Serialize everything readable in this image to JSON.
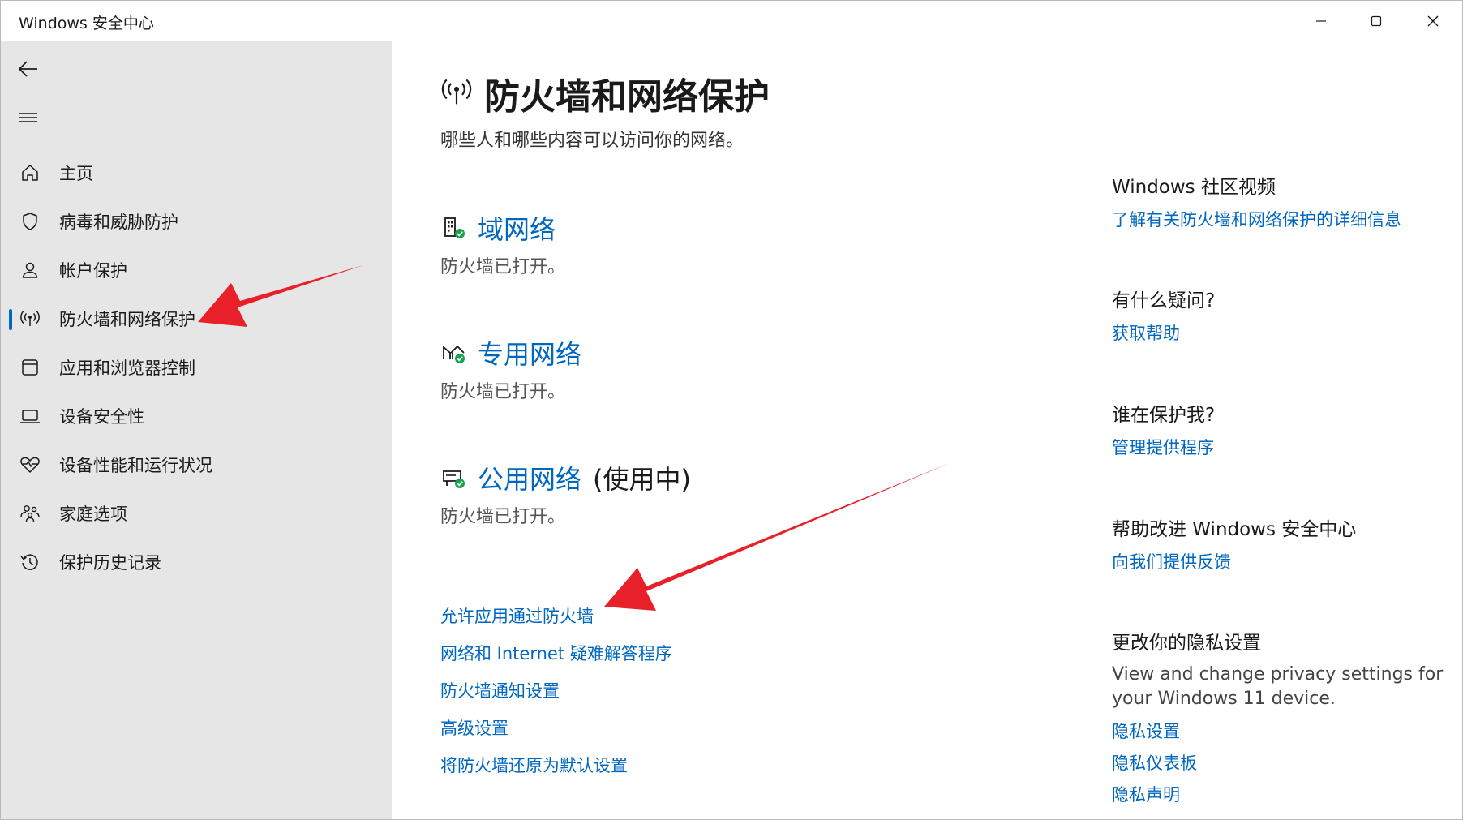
{
  "window": {
    "title": "Windows 安全中心"
  },
  "sidebar": {
    "items": [
      {
        "label": "主页",
        "icon": "home-icon"
      },
      {
        "label": "病毒和威胁防护",
        "icon": "shield-icon"
      },
      {
        "label": "帐户保护",
        "icon": "person-icon"
      },
      {
        "label": "防火墙和网络保护",
        "icon": "antenna-icon",
        "active": true
      },
      {
        "label": "应用和浏览器控制",
        "icon": "browser-window-icon"
      },
      {
        "label": "设备安全性",
        "icon": "laptop-icon"
      },
      {
        "label": "设备性能和运行状况",
        "icon": "heart-pulse-icon"
      },
      {
        "label": "家庭选项",
        "icon": "family-icon"
      },
      {
        "label": "保护历史记录",
        "icon": "history-icon"
      }
    ]
  },
  "main": {
    "title": "防火墙和网络保护",
    "subtitle": "哪些人和哪些内容可以访问你的网络。",
    "networks": [
      {
        "name": "域网络",
        "status": "防火墙已打开。",
        "icon": "domain-network-icon"
      },
      {
        "name": "专用网络",
        "status": "防火墙已打开。",
        "icon": "private-network-icon"
      },
      {
        "name": "公用网络",
        "in_use": "(使用中)",
        "status": "防火墙已打开。",
        "icon": "public-network-icon"
      }
    ],
    "links": [
      "允许应用通过防火墙",
      "网络和 Internet 疑难解答程序",
      "防火墙通知设置",
      "高级设置",
      "将防火墙还原为默认设置"
    ]
  },
  "right": {
    "community": {
      "heading": "Windows 社区视频",
      "link": "了解有关防火墙和网络保护的详细信息"
    },
    "question": {
      "heading": "有什么疑问?",
      "link": "获取帮助"
    },
    "protector": {
      "heading": "谁在保护我?",
      "link": "管理提供程序"
    },
    "improve": {
      "heading": "帮助改进 Windows 安全中心",
      "link": "向我们提供反馈"
    },
    "privacy": {
      "heading": "更改你的隐私设置",
      "text": "View and change privacy settings for your Windows 11 device.",
      "links": [
        "隐私设置",
        "隐私仪表板",
        "隐私声明"
      ]
    }
  },
  "colors": {
    "accent": "#0067c0",
    "sidebar_bg": "#e6e6e6",
    "status_ok": "#16a34a",
    "annotation_arrow": "#e8202a"
  }
}
